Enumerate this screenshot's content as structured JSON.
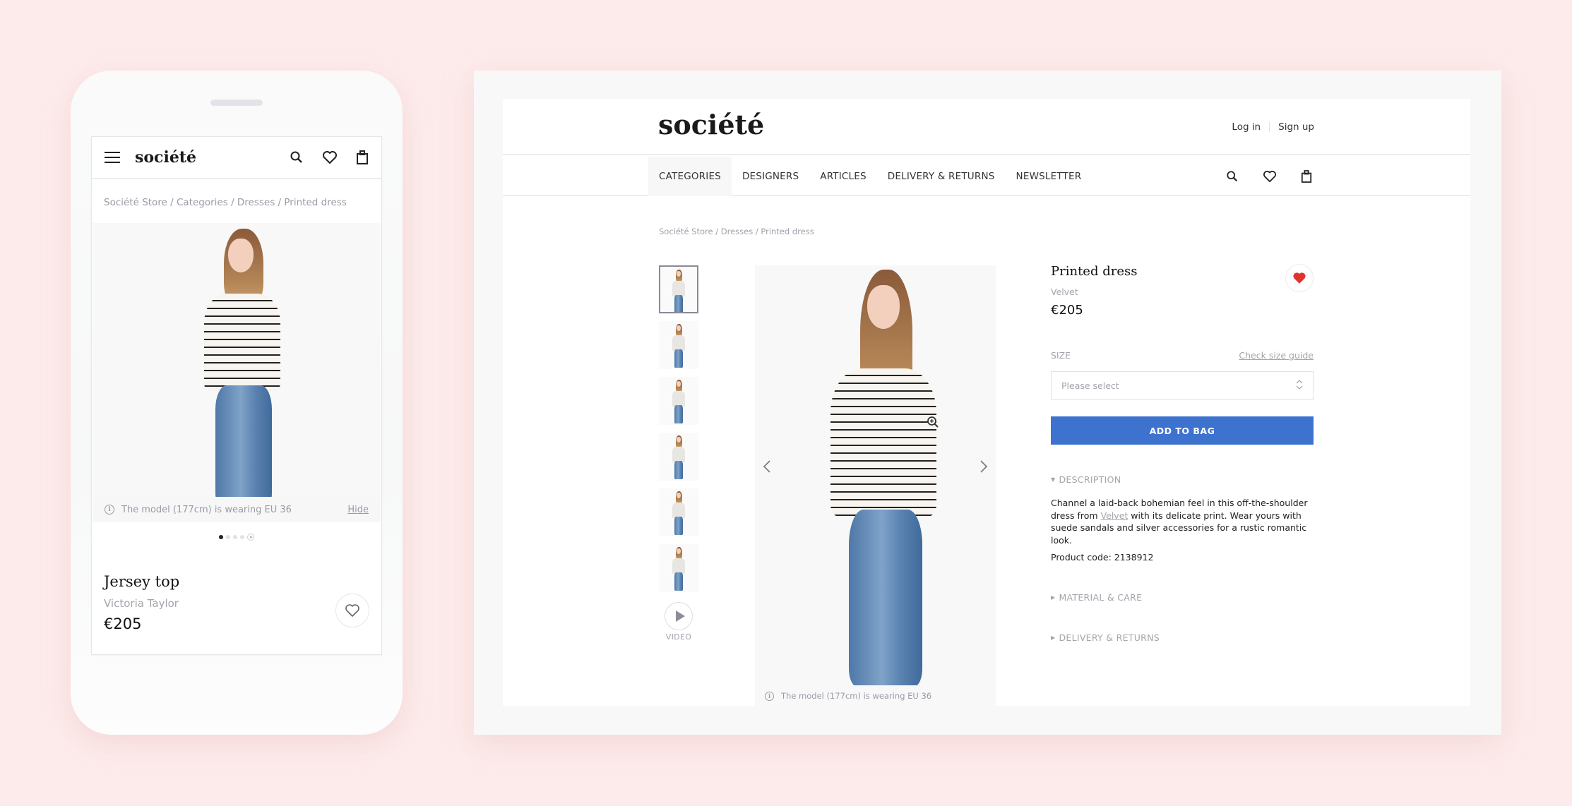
{
  "brand": {
    "logo_text": "société"
  },
  "mobile": {
    "breadcrumb": "Société Store / Categories / Dresses / Printed dress",
    "image_caption": "The model (177cm) is wearing EU 36",
    "hide_label": "Hide",
    "carousel": {
      "total_images": 4,
      "active_index": 0,
      "has_video": true
    },
    "product": {
      "title": "Jersey top",
      "brand": "Victoria Taylor",
      "price": "€205",
      "favorited": false
    },
    "icons": [
      "menu-icon",
      "search-icon",
      "heart-icon",
      "shopping-bag-icon"
    ]
  },
  "desktop": {
    "auth": {
      "login": "Log in",
      "signup": "Sign up"
    },
    "nav": {
      "items": [
        {
          "label": "CATEGORIES",
          "active": true
        },
        {
          "label": "DESIGNERS",
          "active": false
        },
        {
          "label": "ARTICLES",
          "active": false
        },
        {
          "label": "DELIVERY & RETURNS",
          "active": false
        },
        {
          "label": "NEWSLETTER",
          "active": false
        }
      ],
      "icons": [
        "search-icon",
        "heart-icon",
        "shopping-bag-icon"
      ]
    },
    "breadcrumb": "Société Store / Dresses / Printed dress",
    "thumbnails": {
      "count": 6,
      "active_index": 0
    },
    "video_label": "VIDEO",
    "image_caption": "The model (177cm) is wearing EU 36",
    "product": {
      "title": "Printed dress",
      "brand": "Velvet",
      "price": "€205",
      "favorited": true,
      "size_label": "SIZE",
      "size_guide": "Check size guide",
      "size_placeholder": "Please select",
      "add_to_bag": "ADD TO BAG",
      "description_heading": "DESCRIPTION",
      "description_before_link": "Channel a laid-back bohemian feel in this off-the-shoulder dress from ",
      "description_link": "Velvet",
      "description_after_link": " with its delicate print. Wear yours with suede sandals and silver accessories for a rustic romantic look.",
      "product_code": "Product code: 2138912",
      "material_heading": "MATERIAL & CARE",
      "delivery_heading": "DELIVERY & RETURNS"
    }
  },
  "colors": {
    "background": "#fdebeb",
    "accent": "#3e72cf",
    "favorite": "#e0342f",
    "muted_text": "#a4a4ac"
  }
}
